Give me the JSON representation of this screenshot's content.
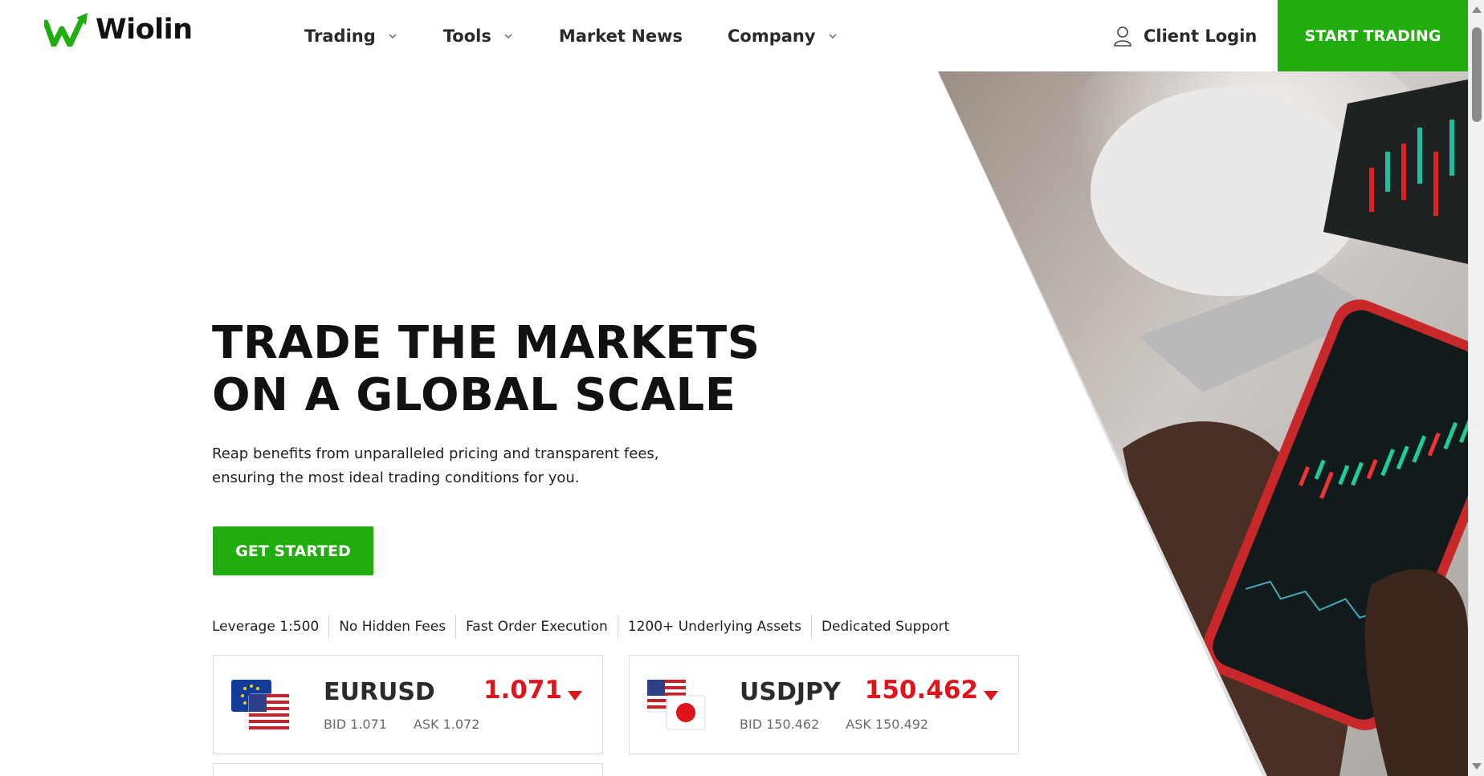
{
  "brand": {
    "name": "Wiolin",
    "accent": "#22ad0f",
    "price_down_color": "#e0141c"
  },
  "nav": {
    "items": [
      {
        "label": "Trading",
        "has_dropdown": true
      },
      {
        "label": "Tools",
        "has_dropdown": true
      },
      {
        "label": "Market News",
        "has_dropdown": false
      },
      {
        "label": "Company",
        "has_dropdown": true
      }
    ],
    "client_login": "Client Login",
    "start_trading": "START TRADING"
  },
  "hero": {
    "title_line1": "TRADE THE MARKETS",
    "title_line2": "ON A GLOBAL SCALE",
    "subtitle_line1": "Reap benefits from unparalleled pricing and transparent fees,",
    "subtitle_line2": "ensuring the most ideal trading conditions for you.",
    "cta": "GET STARTED",
    "image_icon": "trader-phone-chart-photo"
  },
  "features": [
    "Leverage 1:500",
    "No Hidden Fees",
    "Fast Order Execution",
    "1200+ Underlying Assets",
    "Dedicated Support"
  ],
  "tickers": [
    {
      "pair": "EURUSD",
      "price": "1.071",
      "direction": "down",
      "bid": "BID 1.071",
      "ask": "ASK 1.072",
      "flags": [
        "eu-flag-icon",
        "us-flag-icon"
      ]
    },
    {
      "pair": "USDJPY",
      "price": "150.462",
      "direction": "down",
      "bid": "BID 150.462",
      "ask": "ASK 150.492",
      "flags": [
        "us-flag-icon",
        "jp-flag-icon"
      ]
    }
  ]
}
